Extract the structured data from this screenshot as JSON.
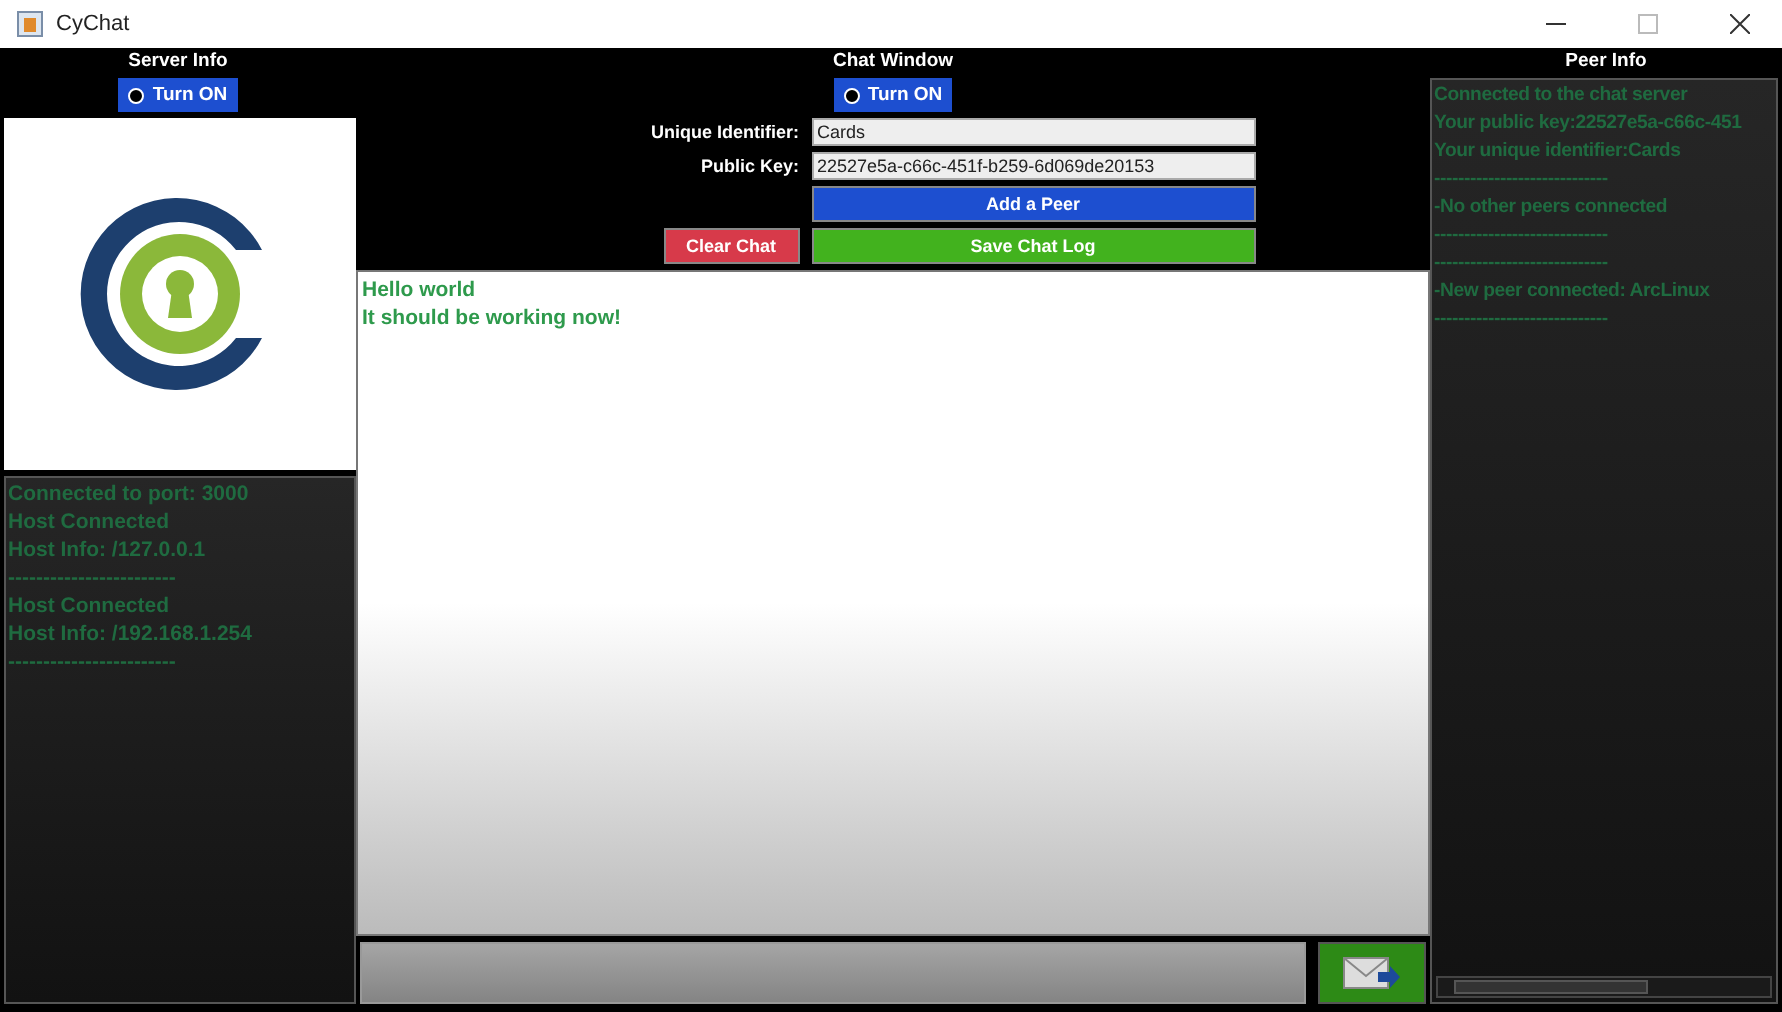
{
  "window": {
    "title": "CyChat"
  },
  "server_info": {
    "title": "Server Info",
    "toggle": {
      "label": "Turn ON",
      "selected": true
    },
    "log": [
      "Connected to port: 3000",
      "Host Connected",
      "Host Info: /127.0.0.1",
      "------------------------",
      "Host Connected",
      "Host Info: /192.168.1.254",
      "------------------------"
    ]
  },
  "chat_window": {
    "title": "Chat Window",
    "toggle": {
      "label": "Turn ON",
      "selected": true
    },
    "fields": [
      {
        "label": "Unique Identifier:",
        "value": "Cards"
      },
      {
        "label": "Public Key:",
        "value": "22527e5a-c66c-451f-b259-6d069de20153"
      }
    ],
    "add_peer_button": "Add a Peer",
    "clear_button": "Clear Chat",
    "save_button": "Save Chat Log",
    "messages": [
      "Hello world",
      "It should be working now!"
    ]
  },
  "peer_info": {
    "title": "Peer Info",
    "log": [
      "Connected to the chat server",
      "Your public key:22527e5a-c66c-451",
      "Your unique identifier:Cards",
      "-----------------------------",
      "-No other peers connected",
      "-----------------------------",
      "-----------------------------",
      "-New peer connected: ArcLinux",
      "-----------------------------"
    ]
  }
}
